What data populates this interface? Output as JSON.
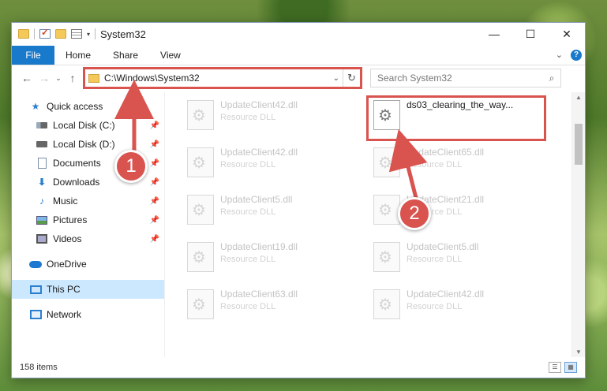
{
  "window": {
    "title": "System32",
    "controls": {
      "minimize": "—",
      "maximize": "☐",
      "close": "✕"
    }
  },
  "ribbon": {
    "tabs": [
      "File",
      "Home",
      "Share",
      "View"
    ],
    "expand": "⌄",
    "help": "?"
  },
  "nav": {
    "back": "←",
    "forward": "→",
    "recent": "⌄",
    "up": "↑"
  },
  "address": {
    "path": "C:\\Windows\\System32",
    "dropdown": "⌄",
    "refresh": "↻"
  },
  "search": {
    "placeholder": "Search System32",
    "icon": "⌕"
  },
  "sidebar": {
    "items": [
      {
        "label": "Quick access",
        "icon": "star-icon"
      },
      {
        "label": "Local Disk (C:)",
        "icon": "disk-icon",
        "pinned": true
      },
      {
        "label": "Local Disk (D:)",
        "icon": "disk-icon",
        "pinned": true
      },
      {
        "label": "Documents",
        "icon": "document-icon",
        "pinned": true
      },
      {
        "label": "Downloads",
        "icon": "download-icon",
        "pinned": true
      },
      {
        "label": "Music",
        "icon": "music-icon",
        "pinned": true
      },
      {
        "label": "Pictures",
        "icon": "pictures-icon",
        "pinned": true
      },
      {
        "label": "Videos",
        "icon": "videos-icon",
        "pinned": true
      },
      {
        "label": "OneDrive",
        "icon": "cloud-icon"
      },
      {
        "label": "This PC",
        "icon": "computer-icon",
        "selected": true
      },
      {
        "label": "Network",
        "icon": "network-icon"
      }
    ]
  },
  "files": [
    {
      "name": "UpdateClient42.dll",
      "type": "Resource DLL"
    },
    {
      "name": "ds03_clearing_the_way...",
      "type": "",
      "active": true
    },
    {
      "name": "UpdateClient42.dll",
      "type": "Resource DLL"
    },
    {
      "name": "UpdateClient65.dll",
      "type": "Resource DLL"
    },
    {
      "name": "UpdateClient5.dll",
      "type": "Resource DLL"
    },
    {
      "name": "UpdateClient21.dll",
      "type": "Resource DLL"
    },
    {
      "name": "UpdateClient19.dll",
      "type": "Resource DLL"
    },
    {
      "name": "UpdateClient5.dll",
      "type": "Resource DLL"
    },
    {
      "name": "UpdateClient63.dll",
      "type": "Resource DLL"
    },
    {
      "name": "UpdateClient42.dll",
      "type": "Resource DLL"
    }
  ],
  "status": {
    "item_count": "158 items"
  },
  "callouts": {
    "step1": "1",
    "step2": "2"
  },
  "colors": {
    "accent": "#1979ca",
    "highlight": "#d9534f",
    "selected": "#cce8ff"
  }
}
